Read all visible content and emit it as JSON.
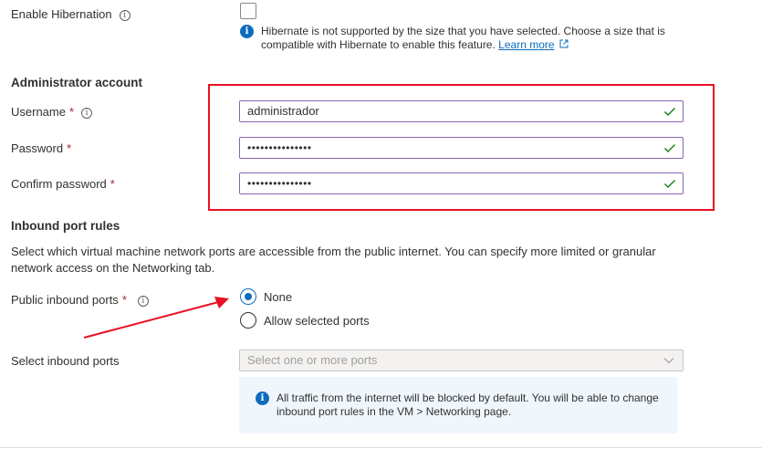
{
  "hibernation": {
    "label": "Enable Hibernation",
    "info_icon": "info-icon",
    "note_text": "Hibernate is not supported by the size that you have selected. Choose a size that is compatible with Hibernate to enable this feature.",
    "learn_more": "Learn more",
    "checked": false
  },
  "admin": {
    "title": "Administrator account",
    "username_label": "Username",
    "username_value": "administrador",
    "password_label": "Password",
    "password_value": "•••••••••••••••",
    "confirm_label": "Confirm password",
    "confirm_value": "•••••••••••••••",
    "required_mark": "*"
  },
  "inbound": {
    "title": "Inbound port rules",
    "description": "Select which virtual machine network ports are accessible from the public internet. You can specify more limited or granular network access on the Networking tab.",
    "public_label": "Public inbound ports",
    "options": [
      "None",
      "Allow selected ports"
    ],
    "selected_option": "None",
    "select_label": "Select inbound ports",
    "select_placeholder": "Select one or more ports",
    "info_text": "All traffic from the internet will be blocked by default. You will be able to change inbound port rules in the VM > Networking page."
  },
  "colors": {
    "accent": "#0f6cbd",
    "annotation_red": "#e81123",
    "valid_green": "#107c10",
    "focus_purple": "#8764b8"
  }
}
